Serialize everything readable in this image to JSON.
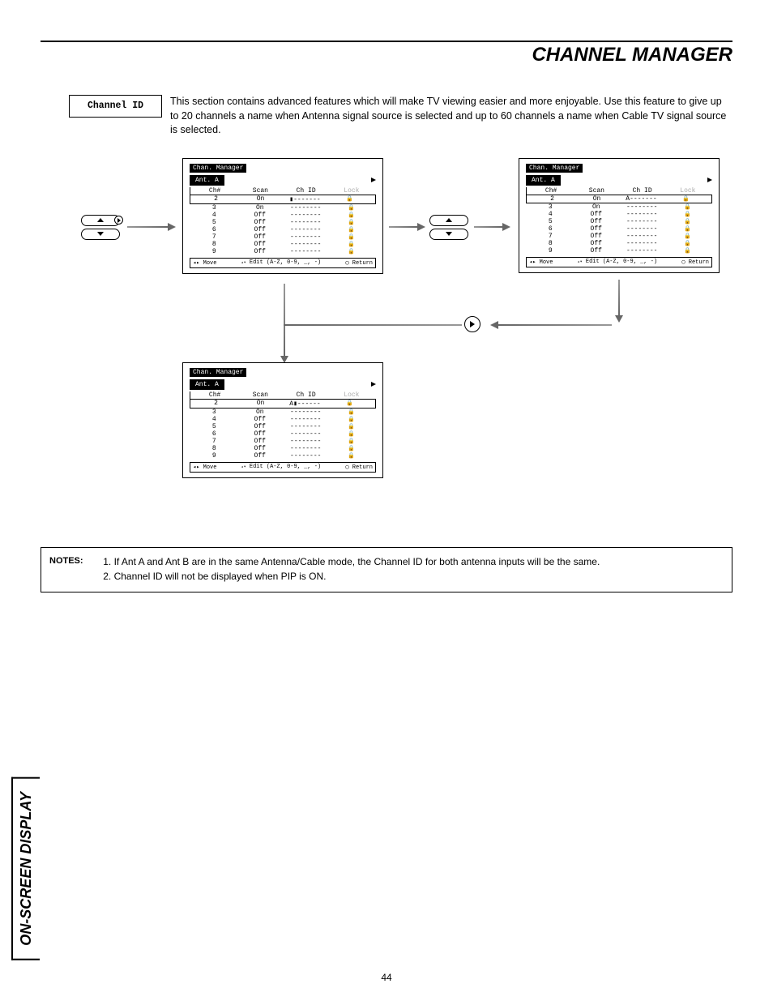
{
  "header": {
    "title": "CHANNEL MANAGER",
    "section_label": "Channel ID"
  },
  "intro": "This section contains advanced features which will make TV viewing easier and more enjoyable. Use this feature to give up to 20 channels a name when Antenna signal source is selected and up to 60 channels a name when Cable TV signal source is selected.",
  "panel_common": {
    "title": "Chan. Manager",
    "subtitle": "Ant. A",
    "cols": {
      "ch": "Ch#",
      "scan": "Scan",
      "chid": "Ch ID",
      "lock": "Lock"
    },
    "hint_move": "Move",
    "hint_edit": "Edit (A-Z, 0-9, _, -)",
    "hint_return": "Return"
  },
  "panels": {
    "top_left": {
      "rows": [
        {
          "ch": "2",
          "scan": "On",
          "chid": "▮-------"
        },
        {
          "ch": "3",
          "scan": "On",
          "chid": "--------"
        },
        {
          "ch": "4",
          "scan": "Off",
          "chid": "--------"
        },
        {
          "ch": "5",
          "scan": "Off",
          "chid": "--------"
        },
        {
          "ch": "6",
          "scan": "Off",
          "chid": "--------"
        },
        {
          "ch": "7",
          "scan": "Off",
          "chid": "--------"
        },
        {
          "ch": "8",
          "scan": "Off",
          "chid": "--------"
        },
        {
          "ch": "9",
          "scan": "Off",
          "chid": "--------"
        }
      ]
    },
    "top_right": {
      "rows": [
        {
          "ch": "2",
          "scan": "On",
          "chid": "A-------"
        },
        {
          "ch": "3",
          "scan": "On",
          "chid": "--------"
        },
        {
          "ch": "4",
          "scan": "Off",
          "chid": "--------"
        },
        {
          "ch": "5",
          "scan": "Off",
          "chid": "--------"
        },
        {
          "ch": "6",
          "scan": "Off",
          "chid": "--------"
        },
        {
          "ch": "7",
          "scan": "Off",
          "chid": "--------"
        },
        {
          "ch": "8",
          "scan": "Off",
          "chid": "--------"
        },
        {
          "ch": "9",
          "scan": "Off",
          "chid": "--------"
        }
      ]
    },
    "bottom": {
      "rows": [
        {
          "ch": "2",
          "scan": "On",
          "chid": "A▮------"
        },
        {
          "ch": "3",
          "scan": "On",
          "chid": "--------"
        },
        {
          "ch": "4",
          "scan": "Off",
          "chid": "--------"
        },
        {
          "ch": "5",
          "scan": "Off",
          "chid": "--------"
        },
        {
          "ch": "6",
          "scan": "Off",
          "chid": "--------"
        },
        {
          "ch": "7",
          "scan": "Off",
          "chid": "--------"
        },
        {
          "ch": "8",
          "scan": "Off",
          "chid": "--------"
        },
        {
          "ch": "9",
          "scan": "Off",
          "chid": "--------"
        }
      ]
    }
  },
  "notes": {
    "label": "NOTES:",
    "items": [
      "If Ant A and Ant B are in the same Antenna/Cable mode, the Channel ID for both antenna inputs will be the same.",
      "Channel ID will not be displayed when PIP is ON."
    ]
  },
  "side_tab": "ON-SCREEN DISPLAY",
  "page_number": "44"
}
